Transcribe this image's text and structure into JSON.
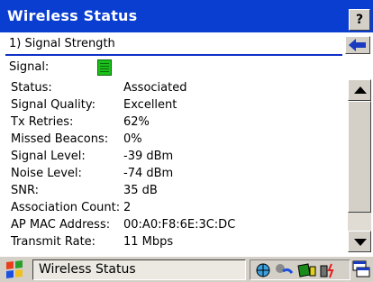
{
  "window": {
    "title": "Wireless Status",
    "help_label": "?"
  },
  "page": {
    "label": "1) Signal Strength",
    "back_icon": "back-arrow-icon"
  },
  "signal": {
    "label": "Signal:",
    "icon": "signal-strength-icon",
    "icon_color": "#1cc01c"
  },
  "details": [
    {
      "key": "Status:",
      "value": "Associated"
    },
    {
      "key": "Signal Quality:",
      "value": "Excellent"
    },
    {
      "key": "Tx Retries:",
      "value": "62%"
    },
    {
      "key": "Missed Beacons:",
      "value": "0%"
    },
    {
      "key": "Signal Level:",
      "value": "-39 dBm"
    },
    {
      "key": "Noise Level:",
      "value": "-74 dBm"
    },
    {
      "key": "SNR:",
      "value": "35 dB"
    },
    {
      "key": "Association Count:",
      "value": "2"
    },
    {
      "key": "AP MAC Address:",
      "value": "00:A0:F8:6E:3C:DC"
    },
    {
      "key": "Transmit Rate:",
      "value": "11 Mbps"
    }
  ],
  "taskbar": {
    "task_label": "Wireless Status",
    "start_icon": "windows-flag-icon",
    "tray_icons": [
      "network-globe-icon",
      "connection-icon",
      "battery-icon",
      "power-icon"
    ],
    "desktop_icon": "show-desktop-icon"
  },
  "colors": {
    "title_bar": "#0a3ed0",
    "chrome": "#d4d0c8",
    "divider": "#1030c8"
  }
}
